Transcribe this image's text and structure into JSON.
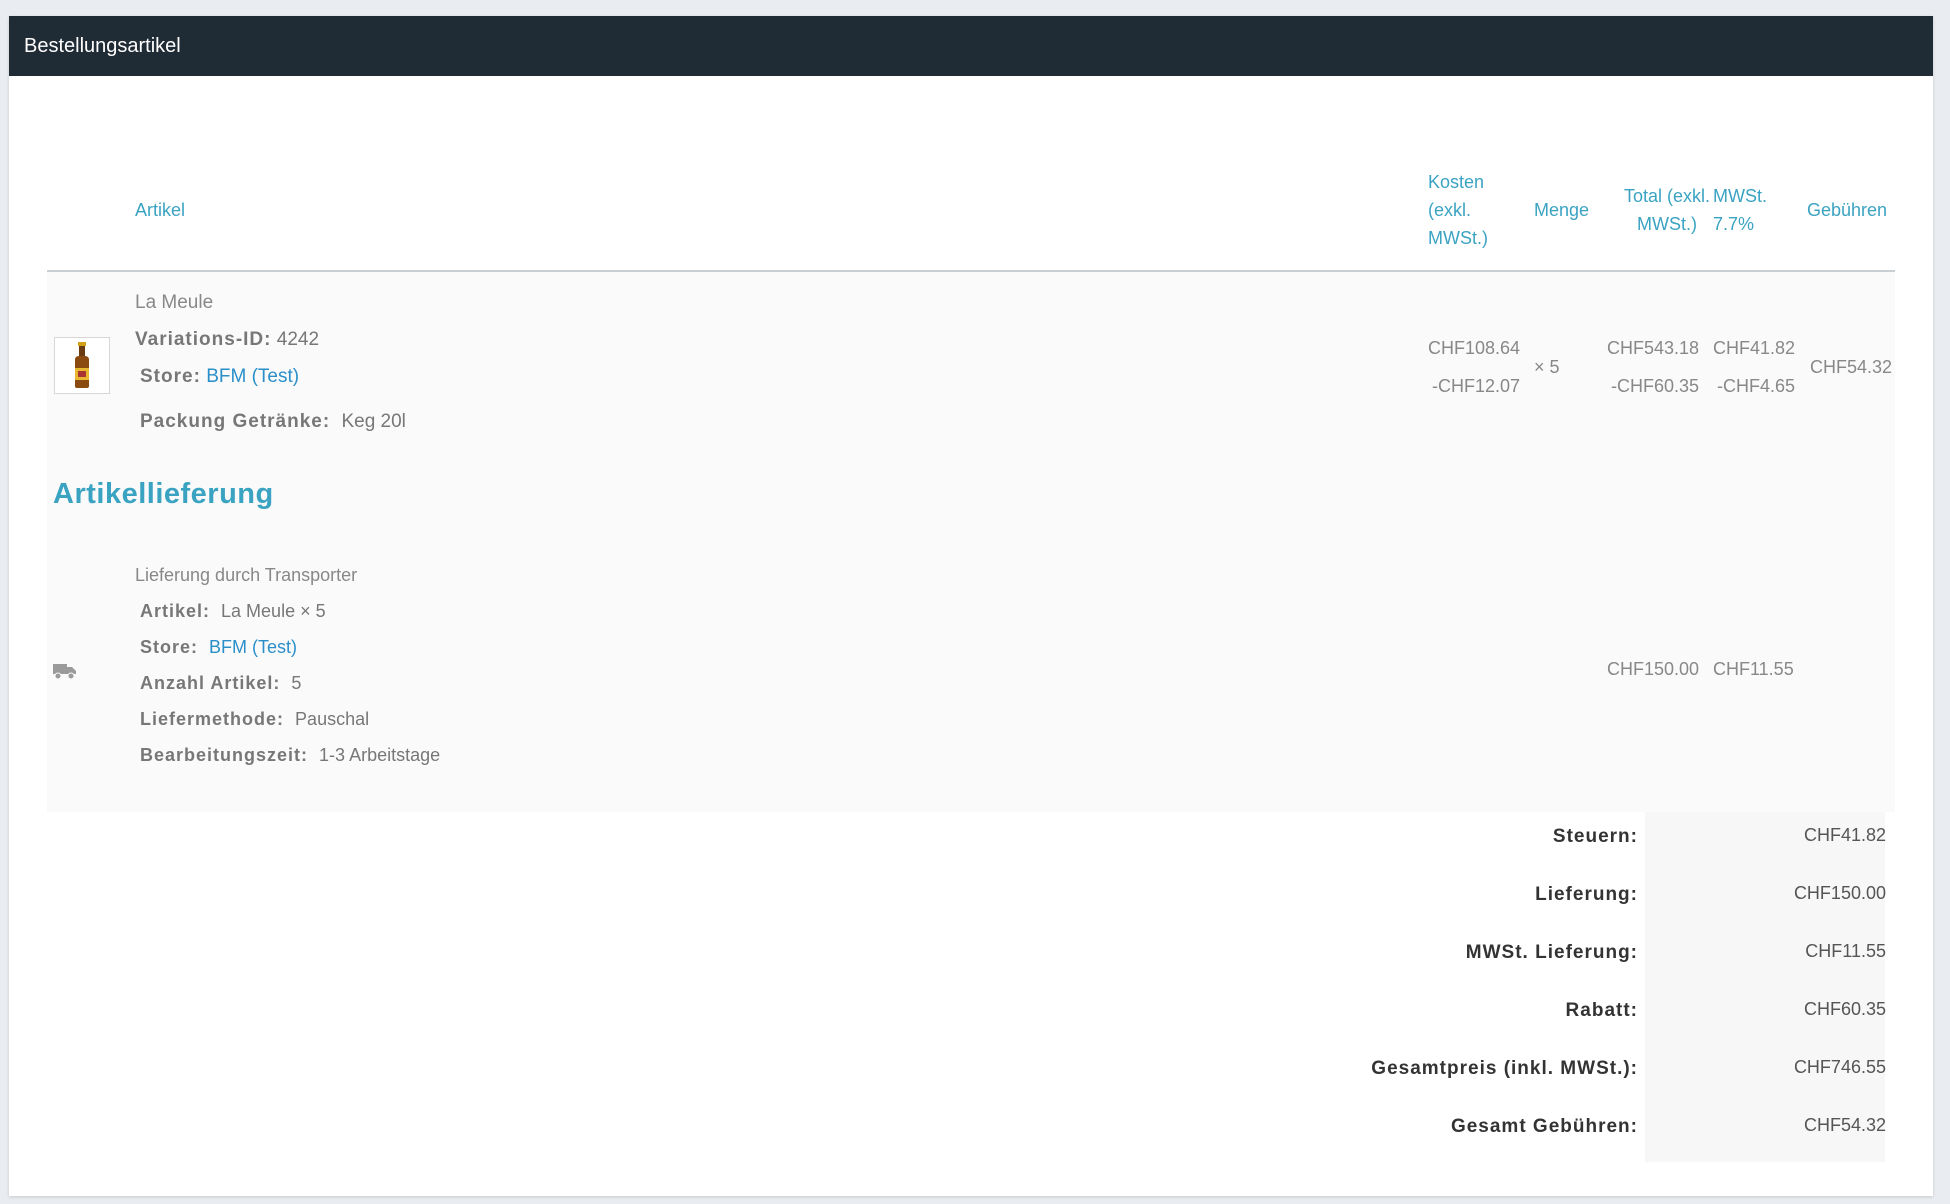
{
  "panel": {
    "title": "Bestellungsartikel"
  },
  "table": {
    "headers": {
      "artikel": "Artikel",
      "kosten_l1": "Kosten",
      "kosten_l2": "(exkl.",
      "kosten_l3": "MWSt.)",
      "menge": "Menge",
      "total_l1": "Total (exkl.",
      "total_l2": "MWSt.)",
      "mwst_l1": "MWSt.",
      "mwst_l2": "7.7%",
      "gebuehren": "Gebühren"
    },
    "item": {
      "name": "La Meule",
      "variation_label": "Variations-ID:",
      "variation_value": "4242",
      "store_label": "Store:",
      "store_value": "BFM (Test)",
      "pack_label": "Packung Getränke:",
      "pack_value": "Keg 20l",
      "cost": "CHF108.64",
      "cost_discount": "-CHF12.07",
      "qty": "× 5",
      "total": "CHF543.18",
      "total_discount": "-CHF60.35",
      "tax": "CHF41.82",
      "tax_discount": "-CHF4.65",
      "fees": "CHF54.32"
    },
    "delivery": {
      "heading": "Artikellieferung",
      "title": "Lieferung durch Transporter",
      "article_label": "Artikel:",
      "article_value": "La Meule × 5",
      "store_label": "Store:",
      "store_value": "BFM (Test)",
      "count_label": "Anzahl Artikel:",
      "count_value": "5",
      "method_label": "Liefermethode:",
      "method_value": "Pauschal",
      "time_label": "Bearbeitungszeit:",
      "time_value": "1-3 Arbeitstage",
      "total": "CHF150.00",
      "tax": "CHF11.55"
    }
  },
  "totals": [
    {
      "label": "Steuern:",
      "value": "CHF41.82"
    },
    {
      "label": "Lieferung:",
      "value": "CHF150.00"
    },
    {
      "label": "MWSt. Lieferung:",
      "value": "CHF11.55"
    },
    {
      "label": "Rabatt:",
      "value": "CHF60.35"
    },
    {
      "label": "Gesamtpreis (inkl. MWSt.):",
      "value": "CHF746.55"
    },
    {
      "label": "Gesamt Gebühren:",
      "value": "CHF54.32"
    }
  ],
  "icons": {
    "product_thumb": "beer-bottle-icon",
    "delivery": "truck-icon"
  },
  "colors": {
    "header_bg": "#1f2b35",
    "accent": "#3aa3c2",
    "link": "#2a8fc9"
  }
}
